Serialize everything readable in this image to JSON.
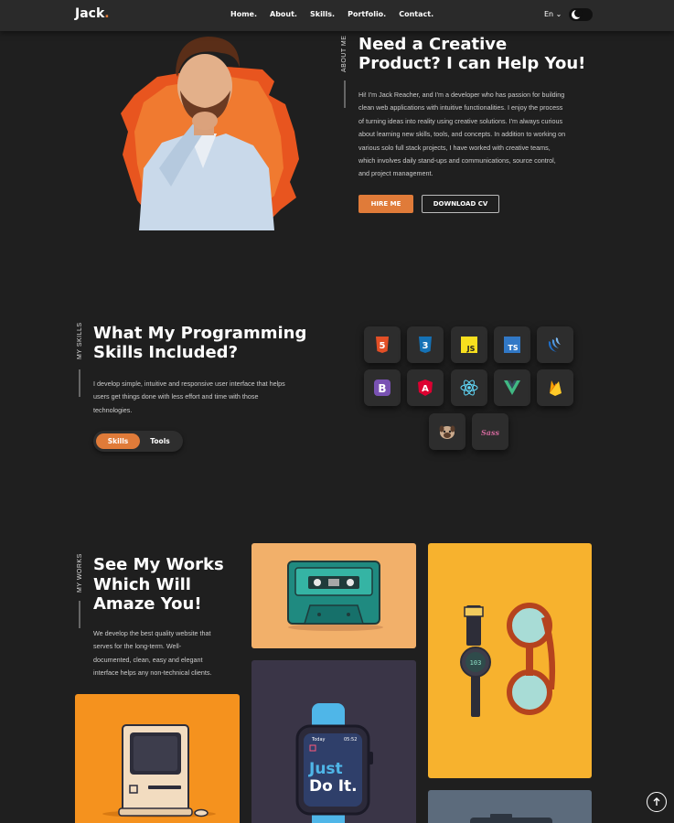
{
  "nav": {
    "logo": "Jack",
    "logo_dot": ".",
    "items": [
      "Home.",
      "About.",
      "Skills.",
      "Portfolio.",
      "Contact."
    ],
    "lang": "En ⌄"
  },
  "about": {
    "side_label": "ABOUT ME",
    "title_line1": "Need a Creative",
    "title_line2": "Product? I can Help You!",
    "paragraph": [
      "Hi! I'm Jack Reacher, and I'm a developer who has passion for building",
      "clean web applications with intuitive functionalities. I enjoy the process",
      "of turning ideas into reality using creative solutions. I'm always curious",
      "about learning new skills, tools, and concepts. In addition to working on",
      "various solo full stack projects, I have worked with creative teams,",
      "which involves daily stand-ups and communications, source control,",
      "and project management."
    ],
    "hire_label": "HIRE ME",
    "cv_label": "DOWNLOAD CV"
  },
  "skills": {
    "side_label": "MY SKILLS",
    "title_line1": "What My Programming",
    "title_line2": "Skills Included?",
    "paragraph": [
      "I develop simple, intuitive and responsive user interface that helps",
      "users get things done with less effort and time with those",
      "technologies."
    ],
    "tabs": [
      "Skills",
      "Tools"
    ],
    "icons": [
      "html5-icon",
      "css3-icon",
      "javascript-icon",
      "typescript-icon",
      "jquery-icon",
      "bootstrap-icon",
      "angular-icon",
      "react-icon",
      "vue-icon",
      "firebase-icon",
      "pug-icon",
      "sass-icon"
    ],
    "labels": {
      "html": "5",
      "css": "3",
      "js": "JS",
      "ts": "TS",
      "bootstrap": "B",
      "angular": "A",
      "sass": "Sass"
    }
  },
  "works": {
    "side_label": "MY WORKS",
    "title_line1": "See My Works",
    "title_line2": "Which Will",
    "title_line3": "Amaze You!",
    "paragraph": [
      "We develop the best quality website that",
      "serves for the long-term. Well-",
      "documented, clean, easy and elegant",
      "interface helps any non-technical clients."
    ],
    "watch_today": "Today",
    "watch_time": "05:52",
    "watch_just": "Just",
    "watch_doit": "Do It.",
    "dial_number": "103"
  },
  "colors": {
    "accent": "#e07b39",
    "bg": "#1f1f1f",
    "nav": "#2a2a2a"
  }
}
